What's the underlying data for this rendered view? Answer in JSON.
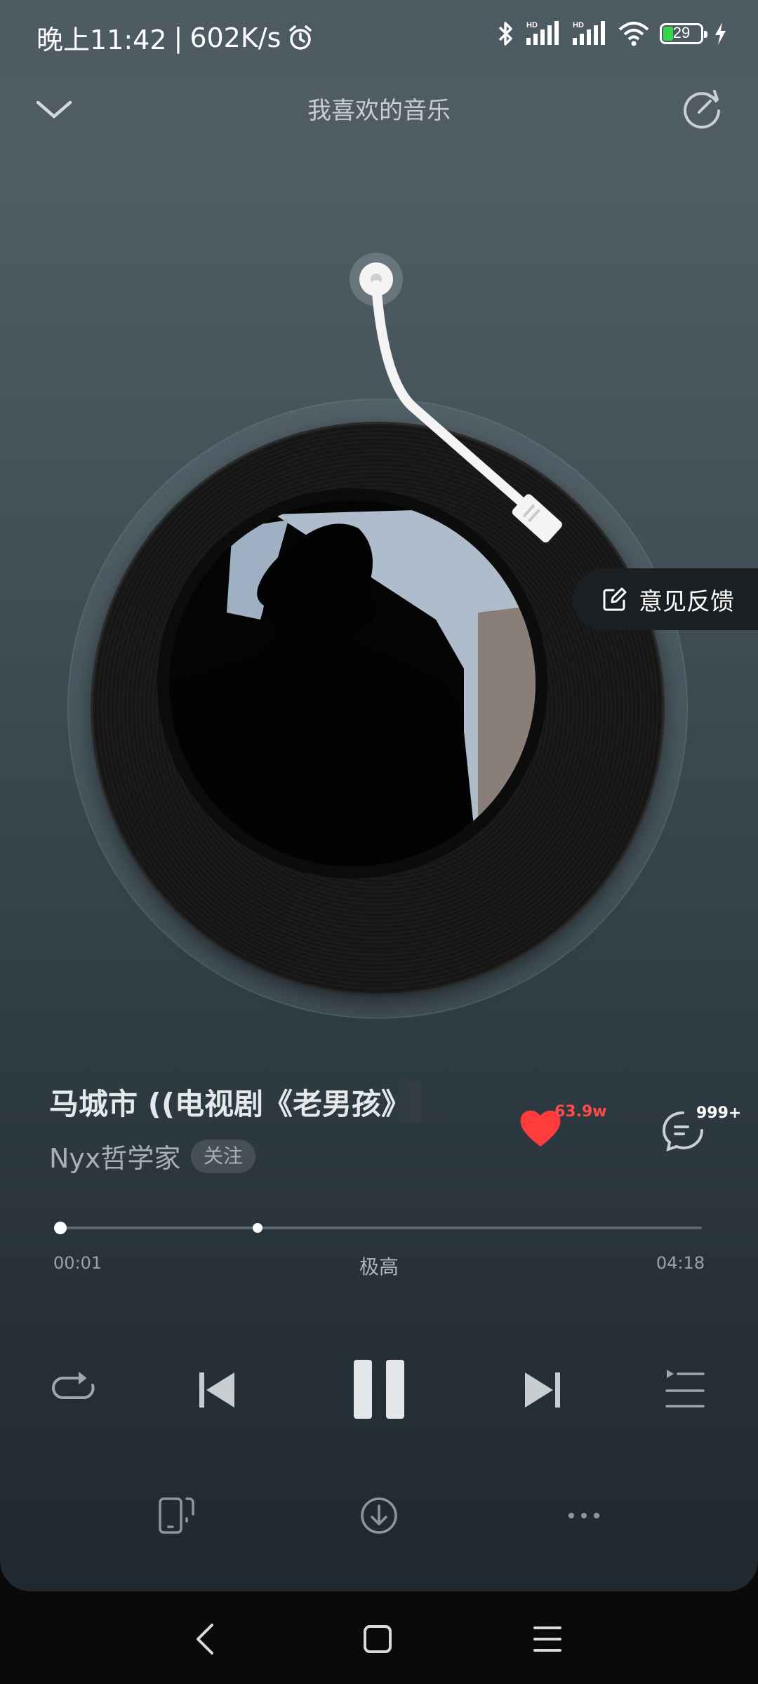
{
  "status_bar": {
    "time": "晚上11:42",
    "speed": "602K/s",
    "battery": "29",
    "icons": [
      "alarm-icon",
      "bluetooth-icon",
      "signal-hd-icon",
      "signal-hd-icon",
      "wifi-icon",
      "battery-icon",
      "charging-icon"
    ]
  },
  "header": {
    "title": "我喜欢的音乐"
  },
  "feedback": {
    "label": "意见反馈"
  },
  "song": {
    "title": "马城市 ((电视剧《老男孩》",
    "artist": "Nyx哲学家",
    "follow_label": "关注",
    "like_count": "63.9w",
    "comment_count": "999+"
  },
  "progress": {
    "current": "00:01",
    "total": "04:18",
    "quality": "极高",
    "played_fraction": 0.004,
    "buffered_fraction": 0.31
  },
  "colors": {
    "like": "#ff3b3b",
    "battery_fill": "#38d64a",
    "background_top": "#4c5a62",
    "background_bottom": "#1f292f"
  }
}
